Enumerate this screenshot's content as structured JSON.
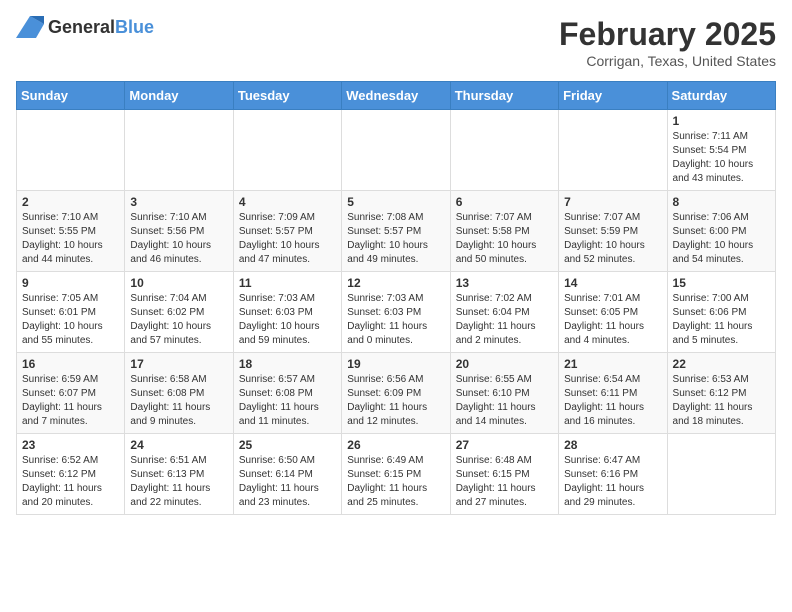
{
  "header": {
    "logo_general": "General",
    "logo_blue": "Blue",
    "month": "February 2025",
    "location": "Corrigan, Texas, United States"
  },
  "weekdays": [
    "Sunday",
    "Monday",
    "Tuesday",
    "Wednesday",
    "Thursday",
    "Friday",
    "Saturday"
  ],
  "weeks": [
    [
      {
        "day": "",
        "info": ""
      },
      {
        "day": "",
        "info": ""
      },
      {
        "day": "",
        "info": ""
      },
      {
        "day": "",
        "info": ""
      },
      {
        "day": "",
        "info": ""
      },
      {
        "day": "",
        "info": ""
      },
      {
        "day": "1",
        "info": "Sunrise: 7:11 AM\nSunset: 5:54 PM\nDaylight: 10 hours and 43 minutes."
      }
    ],
    [
      {
        "day": "2",
        "info": "Sunrise: 7:10 AM\nSunset: 5:55 PM\nDaylight: 10 hours and 44 minutes."
      },
      {
        "day": "3",
        "info": "Sunrise: 7:10 AM\nSunset: 5:56 PM\nDaylight: 10 hours and 46 minutes."
      },
      {
        "day": "4",
        "info": "Sunrise: 7:09 AM\nSunset: 5:57 PM\nDaylight: 10 hours and 47 minutes."
      },
      {
        "day": "5",
        "info": "Sunrise: 7:08 AM\nSunset: 5:57 PM\nDaylight: 10 hours and 49 minutes."
      },
      {
        "day": "6",
        "info": "Sunrise: 7:07 AM\nSunset: 5:58 PM\nDaylight: 10 hours and 50 minutes."
      },
      {
        "day": "7",
        "info": "Sunrise: 7:07 AM\nSunset: 5:59 PM\nDaylight: 10 hours and 52 minutes."
      },
      {
        "day": "8",
        "info": "Sunrise: 7:06 AM\nSunset: 6:00 PM\nDaylight: 10 hours and 54 minutes."
      }
    ],
    [
      {
        "day": "9",
        "info": "Sunrise: 7:05 AM\nSunset: 6:01 PM\nDaylight: 10 hours and 55 minutes."
      },
      {
        "day": "10",
        "info": "Sunrise: 7:04 AM\nSunset: 6:02 PM\nDaylight: 10 hours and 57 minutes."
      },
      {
        "day": "11",
        "info": "Sunrise: 7:03 AM\nSunset: 6:03 PM\nDaylight: 10 hours and 59 minutes."
      },
      {
        "day": "12",
        "info": "Sunrise: 7:03 AM\nSunset: 6:03 PM\nDaylight: 11 hours and 0 minutes."
      },
      {
        "day": "13",
        "info": "Sunrise: 7:02 AM\nSunset: 6:04 PM\nDaylight: 11 hours and 2 minutes."
      },
      {
        "day": "14",
        "info": "Sunrise: 7:01 AM\nSunset: 6:05 PM\nDaylight: 11 hours and 4 minutes."
      },
      {
        "day": "15",
        "info": "Sunrise: 7:00 AM\nSunset: 6:06 PM\nDaylight: 11 hours and 5 minutes."
      }
    ],
    [
      {
        "day": "16",
        "info": "Sunrise: 6:59 AM\nSunset: 6:07 PM\nDaylight: 11 hours and 7 minutes."
      },
      {
        "day": "17",
        "info": "Sunrise: 6:58 AM\nSunset: 6:08 PM\nDaylight: 11 hours and 9 minutes."
      },
      {
        "day": "18",
        "info": "Sunrise: 6:57 AM\nSunset: 6:08 PM\nDaylight: 11 hours and 11 minutes."
      },
      {
        "day": "19",
        "info": "Sunrise: 6:56 AM\nSunset: 6:09 PM\nDaylight: 11 hours and 12 minutes."
      },
      {
        "day": "20",
        "info": "Sunrise: 6:55 AM\nSunset: 6:10 PM\nDaylight: 11 hours and 14 minutes."
      },
      {
        "day": "21",
        "info": "Sunrise: 6:54 AM\nSunset: 6:11 PM\nDaylight: 11 hours and 16 minutes."
      },
      {
        "day": "22",
        "info": "Sunrise: 6:53 AM\nSunset: 6:12 PM\nDaylight: 11 hours and 18 minutes."
      }
    ],
    [
      {
        "day": "23",
        "info": "Sunrise: 6:52 AM\nSunset: 6:12 PM\nDaylight: 11 hours and 20 minutes."
      },
      {
        "day": "24",
        "info": "Sunrise: 6:51 AM\nSunset: 6:13 PM\nDaylight: 11 hours and 22 minutes."
      },
      {
        "day": "25",
        "info": "Sunrise: 6:50 AM\nSunset: 6:14 PM\nDaylight: 11 hours and 23 minutes."
      },
      {
        "day": "26",
        "info": "Sunrise: 6:49 AM\nSunset: 6:15 PM\nDaylight: 11 hours and 25 minutes."
      },
      {
        "day": "27",
        "info": "Sunrise: 6:48 AM\nSunset: 6:15 PM\nDaylight: 11 hours and 27 minutes."
      },
      {
        "day": "28",
        "info": "Sunrise: 6:47 AM\nSunset: 6:16 PM\nDaylight: 11 hours and 29 minutes."
      },
      {
        "day": "",
        "info": ""
      }
    ]
  ]
}
